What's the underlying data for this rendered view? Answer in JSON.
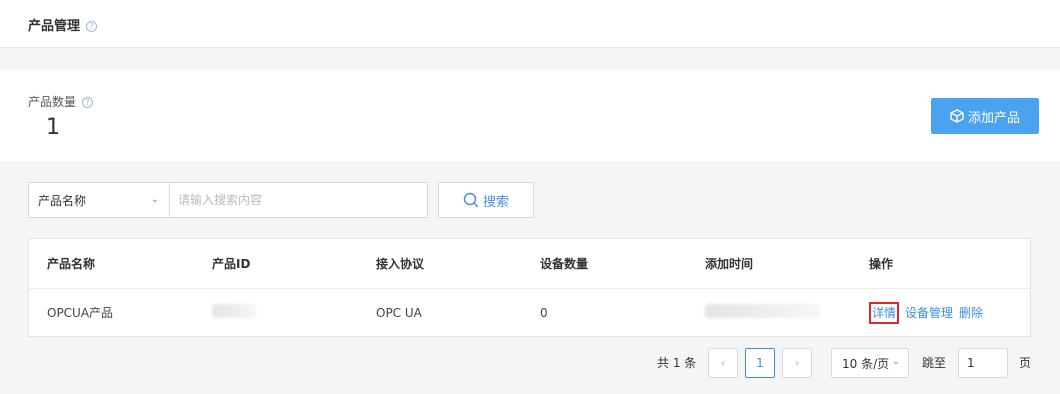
{
  "header": {
    "title": "产品管理",
    "help_glyph": "?"
  },
  "summary": {
    "count_label": "产品数量",
    "help_glyph": "?",
    "count_value": "1",
    "add_button_label": "添加产品"
  },
  "search": {
    "field_selected": "产品名称",
    "placeholder": "请输入搜索内容",
    "button_label": "搜索"
  },
  "table": {
    "columns": [
      "产品名称",
      "产品ID",
      "接入协议",
      "设备数量",
      "添加时间",
      "操作"
    ],
    "rows": [
      {
        "name": "OPCUA产品",
        "protocol": "OPC UA",
        "device_count": "0",
        "actions": {
          "detail": "详情",
          "manage": "设备管理",
          "delete": "删除"
        }
      }
    ]
  },
  "pagination": {
    "total_text": "共 1 条",
    "current_page": "1",
    "prev_glyph": "‹",
    "next_glyph": "›",
    "page_size": "10 条/页",
    "jump_label": "跳至",
    "jump_value": "1",
    "page_unit": "页"
  },
  "colors": {
    "accent": "#4aa3f0",
    "link": "#3b8ee0",
    "highlight_border": "#e02828"
  }
}
